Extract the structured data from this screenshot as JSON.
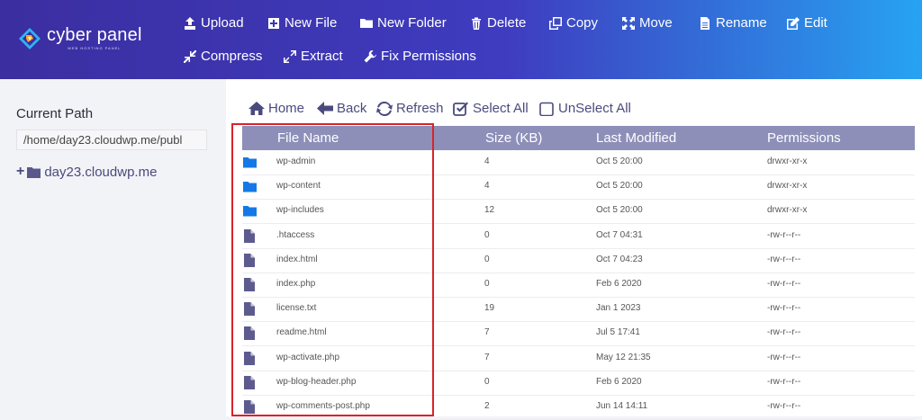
{
  "brand": {
    "title": "cyber panel",
    "subtitle": "WEB HOSTING PANEL"
  },
  "toolbar": {
    "upload": "Upload",
    "new_file": "New File",
    "new_folder": "New Folder",
    "delete": "Delete",
    "copy": "Copy",
    "move": "Move",
    "rename": "Rename",
    "edit": "Edit",
    "compress": "Compress",
    "extract": "Extract",
    "fix_permissions": "Fix Permissions"
  },
  "sidebar": {
    "current_path_label": "Current Path",
    "current_path_value": "/home/day23.cloudwp.me/publ",
    "tree_root": "day23.cloudwp.me"
  },
  "nav": {
    "home": "Home",
    "back": "Back",
    "refresh": "Refresh",
    "select_all": "Select All",
    "unselect_all": "UnSelect All"
  },
  "table": {
    "headers": {
      "name": "File Name",
      "size": "Size (KB)",
      "modified": "Last Modified",
      "permissions": "Permissions"
    },
    "rows": [
      {
        "type": "folder",
        "name": "wp-admin",
        "size": "4",
        "modified": "Oct 5 20:00",
        "permissions": "drwxr-xr-x"
      },
      {
        "type": "folder",
        "name": "wp-content",
        "size": "4",
        "modified": "Oct 5 20:00",
        "permissions": "drwxr-xr-x"
      },
      {
        "type": "folder",
        "name": "wp-includes",
        "size": "12",
        "modified": "Oct 5 20:00",
        "permissions": "drwxr-xr-x"
      },
      {
        "type": "file",
        "name": ".htaccess",
        "size": "0",
        "modified": "Oct 7 04:31",
        "permissions": "-rw-r--r--"
      },
      {
        "type": "file",
        "name": "index.html",
        "size": "0",
        "modified": "Oct 7 04:23",
        "permissions": "-rw-r--r--"
      },
      {
        "type": "file",
        "name": "index.php",
        "size": "0",
        "modified": "Feb 6 2020",
        "permissions": "-rw-r--r--"
      },
      {
        "type": "file",
        "name": "license.txt",
        "size": "19",
        "modified": "Jan 1 2023",
        "permissions": "-rw-r--r--"
      },
      {
        "type": "file",
        "name": "readme.html",
        "size": "7",
        "modified": "Jul 5 17:41",
        "permissions": "-rw-r--r--"
      },
      {
        "type": "file",
        "name": "wp-activate.php",
        "size": "7",
        "modified": "May 12 21:35",
        "permissions": "-rw-r--r--"
      },
      {
        "type": "file",
        "name": "wp-blog-header.php",
        "size": "0",
        "modified": "Feb 6 2020",
        "permissions": "-rw-r--r--"
      },
      {
        "type": "file",
        "name": "wp-comments-post.php",
        "size": "2",
        "modified": "Jun 14 14:11",
        "permissions": "-rw-r--r--"
      }
    ]
  },
  "colors": {
    "folder_icon": "#1479e6",
    "file_icon": "#5d5b8e",
    "header_bg": "#8e8fb9",
    "highlight": "#d8232a"
  }
}
